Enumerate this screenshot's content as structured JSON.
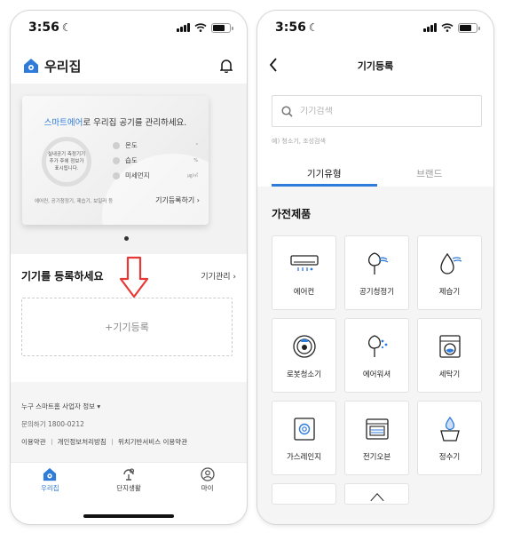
{
  "status_bar": {
    "time": "3:56",
    "moon": "☾"
  },
  "home": {
    "title": "우리집",
    "banner": {
      "headline_accent": "스마트에어",
      "headline_rest": "로 우리집 공기를 관리하세요.",
      "ring_text": "실내공기 측정기기 추가 후에 정보가 표시됩니다.",
      "metrics": [
        {
          "label": "온도",
          "unit": "°"
        },
        {
          "label": "습도",
          "unit": "%"
        },
        {
          "label": "미세먼지",
          "unit": "㎍/㎥"
        }
      ],
      "devices_line": "에어컨, 공기청정기, 제습기, 보일러 등",
      "register_link": "기기등록하기 ›"
    },
    "devices_heading": "기기를 등록하세요",
    "manage_link": "기기관리 ›",
    "add_device": "+기기등록",
    "footer": {
      "business_info": "누구 스마트홈 사업자 정보 ▾",
      "contact": "문의하기 1800-0212",
      "links": [
        "이용약관",
        "개인정보처리방침",
        "위치기반서비스 이용약관"
      ]
    },
    "tabs": [
      {
        "label": "우리집",
        "active": true,
        "icon": "home-icon"
      },
      {
        "label": "단지생활",
        "active": false,
        "icon": "community-icon"
      },
      {
        "label": "마이",
        "active": false,
        "icon": "profile-icon"
      }
    ]
  },
  "register": {
    "title": "기기등록",
    "search_placeholder": "기기검색",
    "search_hint": "예) 청소기, 조성검색",
    "tabs": [
      {
        "label": "기기유형",
        "active": true
      },
      {
        "label": "브랜드",
        "active": false
      }
    ],
    "section_title": "가전제품",
    "devices": [
      {
        "name": "에어컨",
        "icon": "air-conditioner-icon"
      },
      {
        "name": "공기청정기",
        "icon": "air-purifier-icon"
      },
      {
        "name": "제습기",
        "icon": "dehumidifier-icon"
      },
      {
        "name": "로봇청소기",
        "icon": "robot-vacuum-icon"
      },
      {
        "name": "에어워셔",
        "icon": "air-washer-icon"
      },
      {
        "name": "세탁기",
        "icon": "washing-machine-icon"
      },
      {
        "name": "가스레인지",
        "icon": "gas-range-icon"
      },
      {
        "name": "전기오븐",
        "icon": "electric-oven-icon"
      },
      {
        "name": "정수기",
        "icon": "water-purifier-icon"
      }
    ]
  },
  "colors": {
    "accent": "#2f7bd9",
    "arrow": "#e53935"
  }
}
